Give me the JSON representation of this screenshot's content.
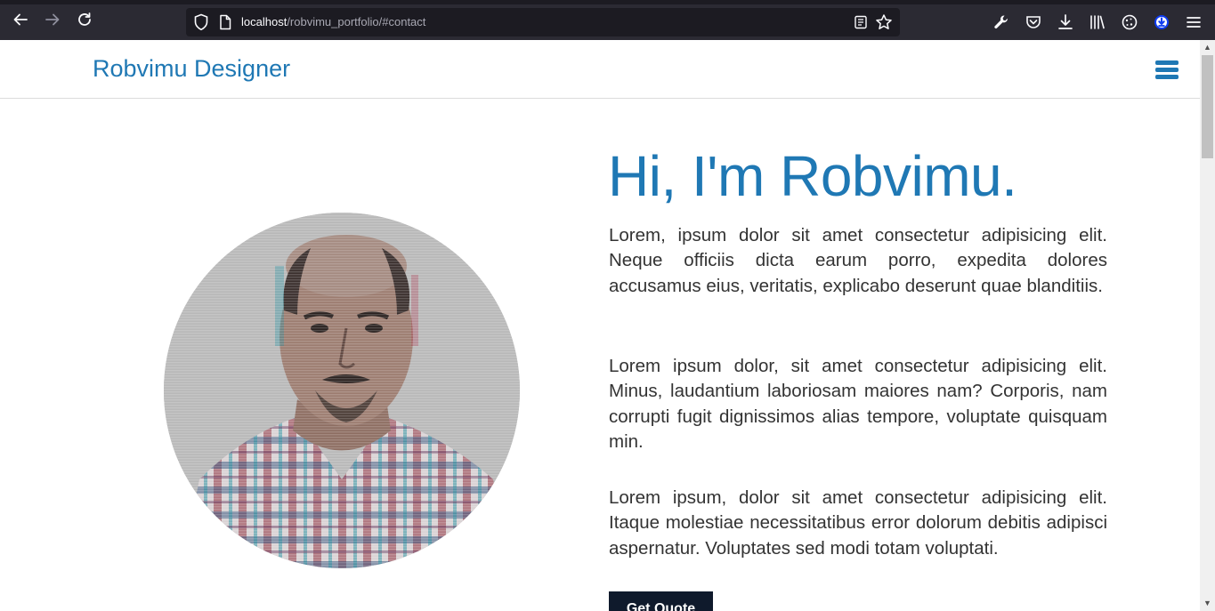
{
  "browser": {
    "url_host": "localhost",
    "url_path": "/robvimu_portfolio/#contact",
    "back_icon": "arrow-left-icon",
    "forward_icon": "arrow-right-icon",
    "reload_icon": "reload-icon"
  },
  "site": {
    "brand": "Robvimu Designer",
    "menu_icon": "hamburger-icon"
  },
  "hero": {
    "title": "Hi, I'm Robvimu.",
    "paragraphs": [
      "Lorem, ipsum dolor sit amet consectetur adipisicing elit. Neque officiis dicta earum porro, expedita dolores accusamus eius, veritatis, explicabo deserunt quae blanditiis.",
      "Lorem ipsum dolor, sit amet consectetur adipisicing elit. Minus, laudantium laboriosam maiores nam? Corporis, nam corrupti fugit dignissimos alias tempore, voluptate quisquam min.",
      "Lorem ipsum, dolor sit amet consectetur adipisicing elit. Itaque molestiae necessitatibus error dolorum debitis adipisci aspernatur. Voluptates sed modi totam voluptati."
    ],
    "cta_label": "Get Quote"
  },
  "colors": {
    "accent": "#1f78b4",
    "cta_bg": "#0f1a2c",
    "chrome_bg": "#2b2a33"
  }
}
